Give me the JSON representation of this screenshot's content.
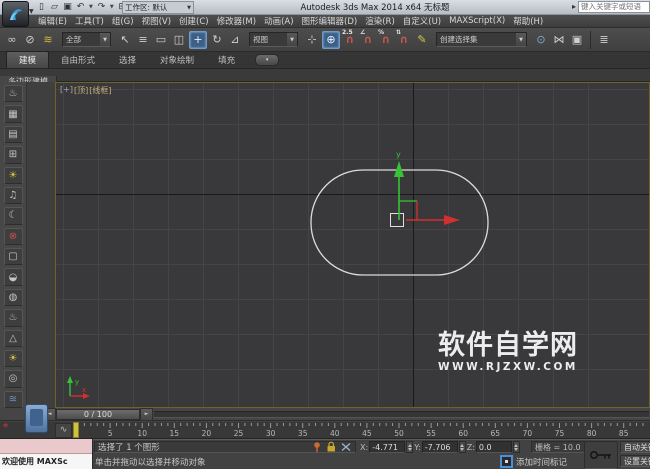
{
  "title_bar": {
    "title": "Autodesk 3ds Max 2014 x64   无标题",
    "workspace_label": "工作区: 默认",
    "search_placeholder": "键入关键字或短语",
    "quick_access": [
      {
        "name": "new-scene-icon",
        "glyph": "▯"
      },
      {
        "name": "open-file-icon",
        "glyph": "▱"
      },
      {
        "name": "save-file-icon",
        "glyph": "▣"
      },
      {
        "name": "undo-icon",
        "glyph": "↶",
        "caret": true
      },
      {
        "name": "redo-icon",
        "glyph": "↷",
        "caret": true
      },
      {
        "name": "project-folder-icon",
        "glyph": "⊞"
      }
    ]
  },
  "menu_bar": {
    "items": [
      "编辑(E)",
      "工具(T)",
      "组(G)",
      "视图(V)",
      "创建(C)",
      "修改器(M)",
      "动画(A)",
      "图形编辑器(D)",
      "渲染(R)",
      "自定义(U)",
      "MAXScript(X)",
      "帮助(H)"
    ]
  },
  "toolbar": {
    "items": [
      {
        "t": "icon",
        "name": "select-and-link-icon",
        "g": "∞"
      },
      {
        "t": "icon",
        "name": "unlink-selection-icon",
        "g": "⊘"
      },
      {
        "t": "icon",
        "name": "bind-to-space-warp-icon",
        "g": "≋",
        "c": "#d4b83c"
      },
      {
        "t": "dd",
        "name": "selection-filter-dropdown",
        "label": "全部",
        "w": 44
      },
      {
        "t": "icon",
        "name": "select-object-icon",
        "g": "↖"
      },
      {
        "t": "icon",
        "name": "select-by-name-icon",
        "g": "≡"
      },
      {
        "t": "icon",
        "name": "rectangular-selection-region-icon",
        "g": "▭"
      },
      {
        "t": "icon",
        "name": "window-crossing-icon",
        "g": "◫"
      },
      {
        "t": "icon",
        "name": "select-and-move-icon",
        "g": "+",
        "active": true
      },
      {
        "t": "icon",
        "name": "select-and-rotate-icon",
        "g": "↻"
      },
      {
        "t": "icon",
        "name": "select-and-scale-icon",
        "g": "⊿"
      },
      {
        "t": "dd",
        "name": "reference-coordinate-dropdown",
        "label": "视图",
        "w": 44
      },
      {
        "t": "icon",
        "name": "use-pivot-center-icon",
        "g": "⊹"
      },
      {
        "t": "icon",
        "name": "select-and-manipulate-icon",
        "g": "⊕",
        "active": true
      },
      {
        "t": "snap",
        "name": "snap-toggle-icon",
        "g": "∩",
        "badge": "2.5"
      },
      {
        "t": "snap",
        "name": "angle-snap-icon",
        "g": "∩",
        "badge": "∠"
      },
      {
        "t": "snap",
        "name": "percent-snap-icon",
        "g": "∩",
        "badge": "%"
      },
      {
        "t": "snap",
        "name": "spinner-snap-icon",
        "g": "∩",
        "badge": "⇅"
      },
      {
        "t": "icon",
        "name": "edit-named-selections-icon",
        "g": "✎",
        "c": "#d4c84a"
      },
      {
        "t": "dd",
        "name": "named-selection-sets-dropdown",
        "label": "创建选择集",
        "w": 86
      },
      {
        "t": "icon",
        "name": "isolate-selection-icon",
        "g": "⊙",
        "c": "#7fa8d9"
      },
      {
        "t": "icon",
        "name": "mirror-icon",
        "g": "⋈"
      },
      {
        "t": "icon",
        "name": "align-icon",
        "g": "▣"
      },
      {
        "t": "sep"
      },
      {
        "t": "icon",
        "name": "layer-manager-icon",
        "g": "≣"
      }
    ]
  },
  "ribbon": {
    "tabs": [
      {
        "label": "建模",
        "active": true
      },
      {
        "label": "自由形式",
        "active": false
      },
      {
        "label": "选择",
        "active": false
      },
      {
        "label": "对象绘制",
        "active": false
      },
      {
        "label": "填充",
        "active": false
      }
    ],
    "toggle_glyph": "▾",
    "panel_tab": "多边形建模"
  },
  "left_toolbar": {
    "icons": [
      {
        "name": "render-teapot-icon",
        "glyph": "♨"
      },
      {
        "name": "rendered-frame-icon",
        "glyph": "▦"
      },
      {
        "name": "render-setup-icon",
        "glyph": "▤"
      },
      {
        "name": "material-editor-icon",
        "glyph": "⊞"
      },
      {
        "name": "light-bulb-icon",
        "glyph": "☀",
        "color": "#d8c048"
      },
      {
        "name": "sound-icon",
        "glyph": "♫"
      },
      {
        "name": "moon-icon",
        "glyph": "☾"
      },
      {
        "name": "motion-red-icon",
        "glyph": "⊗",
        "color": "#c05050"
      },
      {
        "name": "box-primitive-icon",
        "glyph": "▢"
      },
      {
        "name": "dome-primitive-icon",
        "glyph": "◒"
      },
      {
        "name": "sphere-primitive-icon",
        "glyph": "◍"
      },
      {
        "name": "teapot-primitive-icon",
        "glyph": "♨"
      },
      {
        "name": "cone-primitive-icon",
        "glyph": "△"
      },
      {
        "name": "sun-icon",
        "glyph": "☀",
        "color": "#d8c048"
      },
      {
        "name": "disc-primitive-icon",
        "glyph": "◎"
      },
      {
        "name": "waves-icon",
        "glyph": "≋",
        "color": "#7090c0"
      }
    ]
  },
  "viewport": {
    "menu_label": "[+]",
    "view_label": "[顶]",
    "shading_label": "[线框]",
    "gizmo_y_label": "y",
    "tripod_x_label": "x",
    "tripod_y_label": "y",
    "watermark_line1": "软件自学网",
    "watermark_line2": "WWW.RJZXW.COM"
  },
  "timeline": {
    "prev_label": "◄",
    "next_label": "►",
    "slider_value": "0 / 100",
    "mini_curve_editor_glyph": "∿",
    "ruler_numbers": [
      5,
      10,
      15,
      20,
      25,
      30,
      35,
      40,
      45,
      50,
      55,
      60,
      65,
      70,
      75,
      80,
      85
    ]
  },
  "status_bar": {
    "listener_text": "欢迎使用 MAXSc",
    "status_text": "选择了 1 个图形",
    "prompt_text": "单击并拖动以选择并移动对象",
    "x_label": "X:",
    "x_value": "-4.771",
    "y_label": "Y:",
    "y_value": "-7.706",
    "z_label": "Z:",
    "z_value": "0.0",
    "grid_label": "栅格 = 10.0",
    "add_time_tag_label": "添加时间标记",
    "auto_key_label": "自动关键点",
    "set_key_label": "设置关键点"
  },
  "colors": {
    "toolbar_active_blue": "#3c5f88",
    "viewport_background": "#39383b",
    "gizmo_x_axis_red": "#d23030",
    "gizmo_y_axis_green": "#35c435",
    "timeline_marker_yellow": "#cfc23e",
    "listener_pink": "#e9c9cb",
    "active_viewport_border": "#6e6428"
  }
}
